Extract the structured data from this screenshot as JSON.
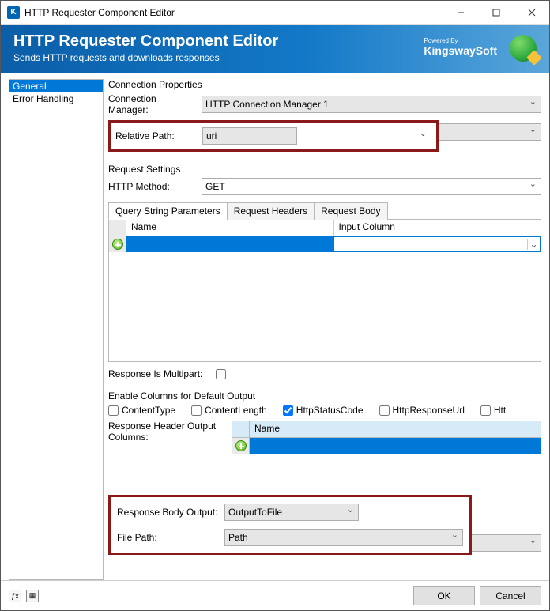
{
  "window": {
    "title": "HTTP Requester Component Editor"
  },
  "header": {
    "title": "HTTP Requester Component Editor",
    "subtitle": "Sends HTTP requests and downloads responses",
    "powered_by": "Powered By",
    "brand": "KingswaySoft"
  },
  "sidebar": {
    "items": [
      {
        "label": "General",
        "selected": true
      },
      {
        "label": "Error Handling",
        "selected": false
      }
    ]
  },
  "connection": {
    "section_title": "Connection Properties",
    "manager_label": "Connection Manager:",
    "manager_value": "HTTP Connection Manager 1",
    "relpath_label": "Relative Path:",
    "relpath_value": "uri"
  },
  "request": {
    "section_title": "Request Settings",
    "method_label": "HTTP Method:",
    "method_value": "GET",
    "tabs": [
      "Query String Parameters",
      "Request Headers",
      "Request Body"
    ],
    "grid": {
      "col_name": "Name",
      "col_input": "Input Column"
    },
    "multipart_label": "Response Is Multipart:"
  },
  "defaults": {
    "section_title": "Enable Columns for Default Output",
    "cols": {
      "content_type": "ContentType",
      "content_length": "ContentLength",
      "http_status": "HttpStatusCode",
      "http_resp_url": "HttpResponseUrl",
      "htt": "Htt"
    },
    "header_cols_label": "Response Header Output Columns:",
    "grid_col": "Name"
  },
  "output": {
    "body_label": "Response Body Output:",
    "body_value": "OutputToFile",
    "path_label": "File Path:",
    "path_value": "Path"
  },
  "buttons": {
    "ok": "OK",
    "cancel": "Cancel"
  }
}
